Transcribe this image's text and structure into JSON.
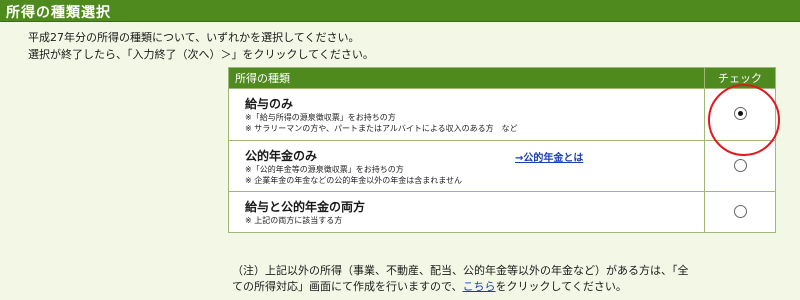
{
  "header": {
    "title": "所得の種類選択"
  },
  "intro": {
    "line1": "平成27年分の所得の種類について、いずれかを選択してください。",
    "line2": "選択が終了したら、「入力終了（次へ）＞」をクリックしてください。"
  },
  "table": {
    "col_type": "所得の種類",
    "col_check": "チェック",
    "rows": [
      {
        "name": "給与のみ",
        "notes": [
          "※「給与所得の源泉徴収票」をお持ちの方",
          "※ サラリーマンの方や、パートまたはアルバイトによる収入のある方　など"
        ],
        "checked": true
      },
      {
        "name": "公的年金のみ",
        "link": "→公的年金とは",
        "notes": [
          "※「公的年金等の源泉徴収票」をお持ちの方",
          "※ 企業年金の年金などの公的年金以外の年金は含まれません"
        ],
        "checked": false
      },
      {
        "name": "給与と公的年金の両方",
        "notes": [
          "※ 上記の両方に該当する方"
        ],
        "checked": false
      }
    ]
  },
  "footnote": {
    "line1": "（注）上記以外の所得（事業、不動産、配当、公的年金等以外の年金など）がある方は、「全",
    "line2_pre": "ての所得対応」画面にて作成を行いますので、",
    "link": "こちら",
    "line2_post": "をクリックしてください。"
  },
  "colors": {
    "header_green": "#4f8a1f",
    "highlight_red": "#e0191e",
    "link_blue": "#1a3fb3"
  }
}
